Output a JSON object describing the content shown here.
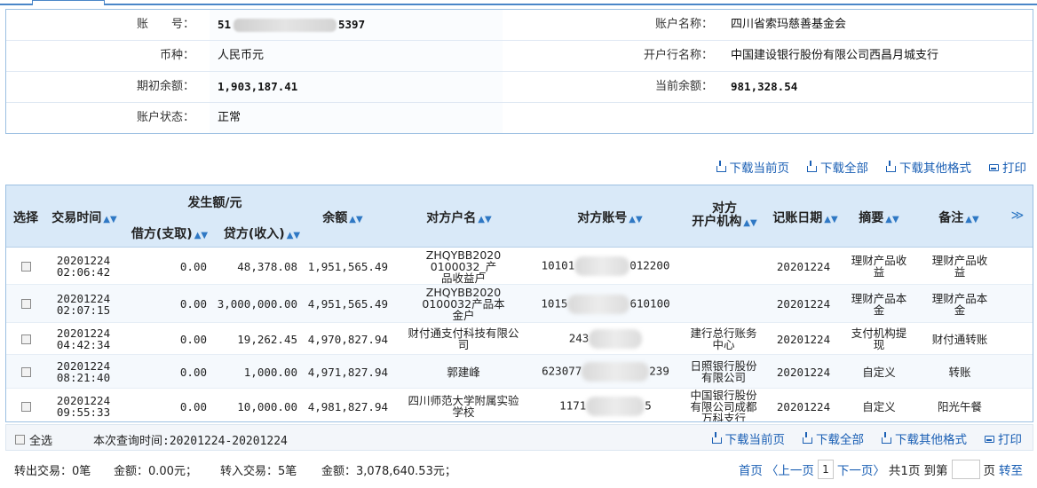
{
  "account": {
    "acct_no_label": "账　　号：",
    "acct_no_prefix": "51",
    "acct_no_suffix": "5397",
    "acct_name_label": "账户名称：",
    "acct_name": "四川省索玛慈善基金会",
    "currency_label": "币种：",
    "currency": "人民币元",
    "bank_label": "开户行名称：",
    "bank": "中国建设银行股份有限公司西昌月城支行",
    "open_bal_label": "期初余额：",
    "open_bal": "1,903,187.41",
    "cur_bal_label": "当前余额：",
    "cur_bal": "981,328.54",
    "status_label": "账户状态：",
    "status": "正常"
  },
  "actions": {
    "dl_current": "下载当前页",
    "dl_all": "下载全部",
    "dl_other": "下载其他格式",
    "print": "打印"
  },
  "table": {
    "h_select": "选择",
    "h_time": "交易时间",
    "h_amount": "发生额/元",
    "h_debit": "借方(支取)",
    "h_credit": "贷方(收入)",
    "h_balance": "余额",
    "h_cp_name": "对方户名",
    "h_cp_acct": "对方账号",
    "h_cp_org_1": "对方",
    "h_cp_org_2": "开户机构",
    "h_date": "记账日期",
    "h_summary": "摘要",
    "h_note": "备注",
    "more": "≫",
    "rows": [
      {
        "date": "20201224",
        "time": "02:06:42",
        "debit": "0.00",
        "credit": "48,378.08",
        "balance": "1,951,565.49",
        "cp_name_1": "ZHQYBB2020",
        "cp_name_2": "0100032_产",
        "cp_name_3": "品收益户",
        "acct_pre": "10101",
        "acct_suf": "012200",
        "org_1": "",
        "org_2": "",
        "org_3": "",
        "book": "20201224",
        "sum_1": "理财产品收",
        "sum_2": "益",
        "note_1": "理财产品收",
        "note_2": "益"
      },
      {
        "date": "20201224",
        "time": "02:07:15",
        "debit": "0.00",
        "credit": "3,000,000.00",
        "balance": "4,951,565.49",
        "cp_name_1": "ZHQYBB2020",
        "cp_name_2": "0100032产品本",
        "cp_name_3": "金户",
        "acct_pre": "1015",
        "acct_suf": "610100",
        "org_1": "",
        "org_2": "",
        "org_3": "",
        "book": "20201224",
        "sum_1": "理财产品本",
        "sum_2": "金",
        "note_1": "理财产品本",
        "note_2": "金"
      },
      {
        "date": "20201224",
        "time": "04:42:34",
        "debit": "0.00",
        "credit": "19,262.45",
        "balance": "4,970,827.94",
        "cp_name_1": "财付通支付科技有限公",
        "cp_name_2": "司",
        "cp_name_3": "",
        "acct_pre": "243",
        "acct_suf": "",
        "org_1": "建行总行账务",
        "org_2": "中心",
        "org_3": "",
        "book": "20201224",
        "sum_1": "支付机构提",
        "sum_2": "现",
        "note_1": "财付通转账",
        "note_2": ""
      },
      {
        "date": "20201224",
        "time": "08:21:40",
        "debit": "0.00",
        "credit": "1,000.00",
        "balance": "4,971,827.94",
        "cp_name_1": "郭建峰",
        "cp_name_2": "",
        "cp_name_3": "",
        "acct_pre": "623077",
        "acct_suf": "239",
        "org_1": "日照银行股份",
        "org_2": "有限公司",
        "org_3": "",
        "book": "20201224",
        "sum_1": "自定义",
        "sum_2": "",
        "note_1": "转账",
        "note_2": ""
      },
      {
        "date": "20201224",
        "time": "09:55:33",
        "debit": "0.00",
        "credit": "10,000.00",
        "balance": "4,981,827.94",
        "cp_name_1": "四川师范大学附属实验",
        "cp_name_2": "学校",
        "cp_name_3": "",
        "acct_pre": "1171",
        "acct_suf": "5",
        "org_1": "中国银行股份",
        "org_2": "有限公司成都",
        "org_3": "万科支行",
        "book": "20201224",
        "sum_1": "自定义",
        "sum_2": "",
        "note_1": "阳光午餐",
        "note_2": ""
      }
    ]
  },
  "footer": {
    "select_all": "全选",
    "query_range": "本次查询时间:20201224-20201224",
    "out_tx": "转出交易：0笔",
    "out_amt": "金额：0.00元；",
    "in_tx": "转入交易：5笔",
    "in_amt": "金额：3,078,640.53元；",
    "first": "首页",
    "prev": "〈上一页",
    "page_num": "1",
    "next": "下一页〉",
    "total": "共1页",
    "goto": "到第",
    "page_unit": "页",
    "go": "转至"
  }
}
